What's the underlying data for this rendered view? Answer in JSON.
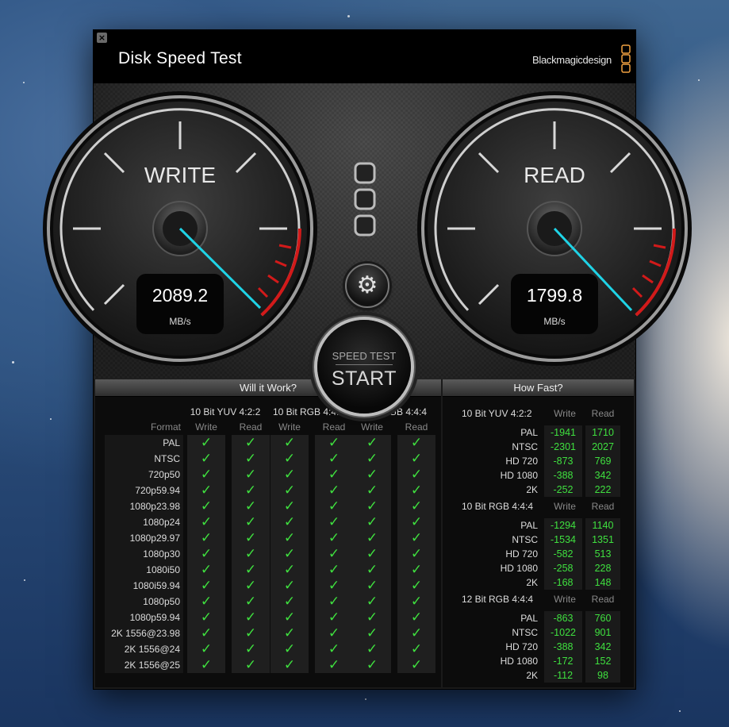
{
  "window": {
    "title": "Disk Speed Test",
    "brand": "Blackmagicdesign",
    "close_glyph": "×"
  },
  "gauges": {
    "write": {
      "label": "WRITE",
      "value": "2089.2",
      "unit": "MB/s",
      "needle_fraction": 0.86
    },
    "read": {
      "label": "READ",
      "value": "1799.8",
      "unit": "MB/s",
      "needle_fraction": 0.84
    }
  },
  "controls": {
    "settings_icon": "gear-icon",
    "start_line1": "SPEED TEST",
    "start_line2": "START"
  },
  "will_it_work": {
    "title": "Will it Work?",
    "format_header": "Format",
    "groups": [
      {
        "name": "10 Bit YUV 4:2:2",
        "write": "Write",
        "read": "Read"
      },
      {
        "name": "10 Bit RGB 4:4:4",
        "write": "Write",
        "read": "Read"
      },
      {
        "name": "12 Bit RGB 4:4:4",
        "write": "Write",
        "read": "Read"
      }
    ],
    "formats": [
      "PAL",
      "NTSC",
      "720p50",
      "720p59.94",
      "1080p23.98",
      "1080p24",
      "1080p29.97",
      "1080p30",
      "1080i50",
      "1080i59.94",
      "1080p50",
      "1080p59.94",
      "2K 1556@23.98",
      "2K 1556@24",
      "2K 1556@25"
    ],
    "check_glyph": "✓",
    "all_pass": true
  },
  "how_fast": {
    "title": "How Fast?",
    "sections": [
      {
        "name": "10 Bit YUV 4:2:2",
        "write": "Write",
        "read": "Read",
        "rows": [
          {
            "label": "PAL",
            "w": "-1941",
            "r": "1710"
          },
          {
            "label": "NTSC",
            "w": "-2301",
            "r": "2027"
          },
          {
            "label": "HD 720",
            "w": "-873",
            "r": "769"
          },
          {
            "label": "HD 1080",
            "w": "-388",
            "r": "342"
          },
          {
            "label": "2K",
            "w": "-252",
            "r": "222"
          }
        ]
      },
      {
        "name": "10 Bit RGB 4:4:4",
        "write": "Write",
        "read": "Read",
        "rows": [
          {
            "label": "PAL",
            "w": "-1294",
            "r": "1140"
          },
          {
            "label": "NTSC",
            "w": "-1534",
            "r": "1351"
          },
          {
            "label": "HD 720",
            "w": "-582",
            "r": "513"
          },
          {
            "label": "HD 1080",
            "w": "-258",
            "r": "228"
          },
          {
            "label": "2K",
            "w": "-168",
            "r": "148"
          }
        ]
      },
      {
        "name": "12 Bit RGB 4:4:4",
        "write": "Write",
        "read": "Read",
        "rows": [
          {
            "label": "PAL",
            "w": "-863",
            "r": "760"
          },
          {
            "label": "NTSC",
            "w": "-1022",
            "r": "901"
          },
          {
            "label": "HD 720",
            "w": "-388",
            "r": "342"
          },
          {
            "label": "HD 1080",
            "w": "-172",
            "r": "152"
          },
          {
            "label": "2K",
            "w": "-112",
            "r": "98"
          }
        ]
      }
    ]
  },
  "colors": {
    "accent_needle": "#1fd3e6",
    "redline": "#d21a1a",
    "pass_green": "#3fe03f",
    "logo_orange": "#f0a040"
  }
}
